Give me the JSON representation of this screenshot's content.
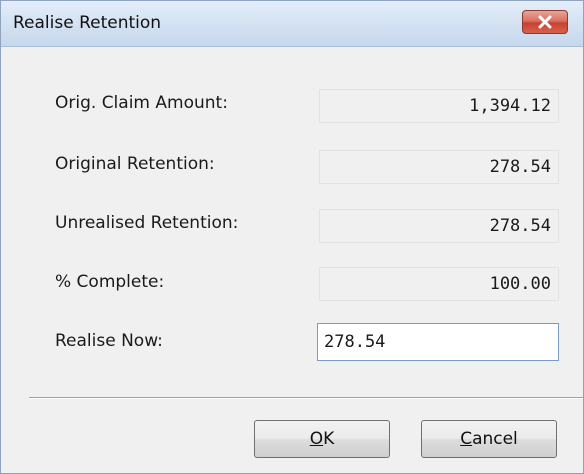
{
  "window": {
    "title": "Realise Retention"
  },
  "fields": [
    {
      "label": "Orig. Claim Amount:",
      "value": "1,394.12"
    },
    {
      "label": "Original Retention:",
      "value": "278.54"
    },
    {
      "label": "Unrealised Retention:",
      "value": "278.54"
    },
    {
      "label": "% Complete:",
      "value": "100.00"
    }
  ],
  "realise_now": {
    "label": "Realise Now:",
    "value": "278.54"
  },
  "buttons": {
    "ok": {
      "mnemonic": "O",
      "rest": "K"
    },
    "cancel": {
      "mnemonic": "C",
      "rest": "ancel"
    }
  },
  "icons": {
    "close": "close-icon"
  },
  "colors": {
    "close_button": "#c74330",
    "titlebar": "#d5e3f3",
    "input_border": "#7a9cc7"
  }
}
